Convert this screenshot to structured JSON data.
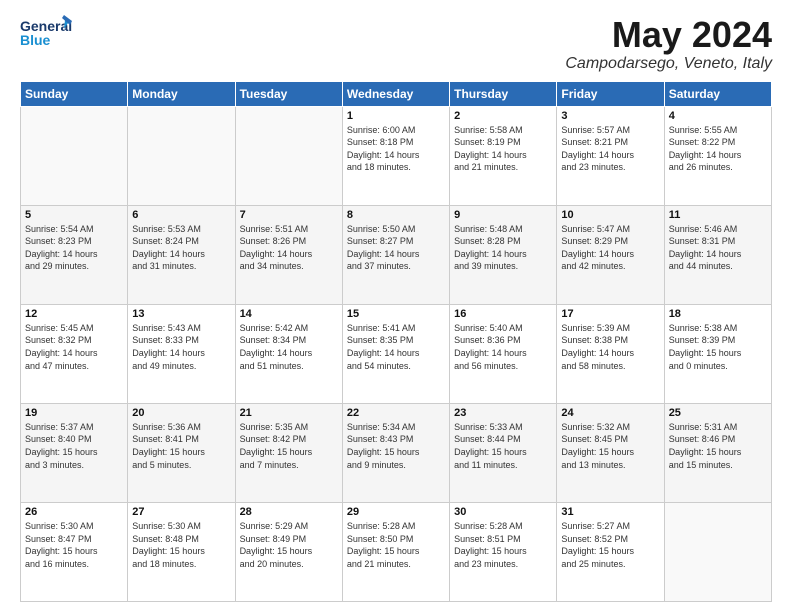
{
  "header": {
    "logo_line1": "General",
    "logo_line2": "Blue",
    "month_title": "May 2024",
    "location": "Campodarsego, Veneto, Italy"
  },
  "days_of_week": [
    "Sunday",
    "Monday",
    "Tuesday",
    "Wednesday",
    "Thursday",
    "Friday",
    "Saturday"
  ],
  "weeks": [
    [
      {
        "day": "",
        "info": ""
      },
      {
        "day": "",
        "info": ""
      },
      {
        "day": "",
        "info": ""
      },
      {
        "day": "1",
        "info": "Sunrise: 6:00 AM\nSunset: 8:18 PM\nDaylight: 14 hours\nand 18 minutes."
      },
      {
        "day": "2",
        "info": "Sunrise: 5:58 AM\nSunset: 8:19 PM\nDaylight: 14 hours\nand 21 minutes."
      },
      {
        "day": "3",
        "info": "Sunrise: 5:57 AM\nSunset: 8:21 PM\nDaylight: 14 hours\nand 23 minutes."
      },
      {
        "day": "4",
        "info": "Sunrise: 5:55 AM\nSunset: 8:22 PM\nDaylight: 14 hours\nand 26 minutes."
      }
    ],
    [
      {
        "day": "5",
        "info": "Sunrise: 5:54 AM\nSunset: 8:23 PM\nDaylight: 14 hours\nand 29 minutes."
      },
      {
        "day": "6",
        "info": "Sunrise: 5:53 AM\nSunset: 8:24 PM\nDaylight: 14 hours\nand 31 minutes."
      },
      {
        "day": "7",
        "info": "Sunrise: 5:51 AM\nSunset: 8:26 PM\nDaylight: 14 hours\nand 34 minutes."
      },
      {
        "day": "8",
        "info": "Sunrise: 5:50 AM\nSunset: 8:27 PM\nDaylight: 14 hours\nand 37 minutes."
      },
      {
        "day": "9",
        "info": "Sunrise: 5:48 AM\nSunset: 8:28 PM\nDaylight: 14 hours\nand 39 minutes."
      },
      {
        "day": "10",
        "info": "Sunrise: 5:47 AM\nSunset: 8:29 PM\nDaylight: 14 hours\nand 42 minutes."
      },
      {
        "day": "11",
        "info": "Sunrise: 5:46 AM\nSunset: 8:31 PM\nDaylight: 14 hours\nand 44 minutes."
      }
    ],
    [
      {
        "day": "12",
        "info": "Sunrise: 5:45 AM\nSunset: 8:32 PM\nDaylight: 14 hours\nand 47 minutes."
      },
      {
        "day": "13",
        "info": "Sunrise: 5:43 AM\nSunset: 8:33 PM\nDaylight: 14 hours\nand 49 minutes."
      },
      {
        "day": "14",
        "info": "Sunrise: 5:42 AM\nSunset: 8:34 PM\nDaylight: 14 hours\nand 51 minutes."
      },
      {
        "day": "15",
        "info": "Sunrise: 5:41 AM\nSunset: 8:35 PM\nDaylight: 14 hours\nand 54 minutes."
      },
      {
        "day": "16",
        "info": "Sunrise: 5:40 AM\nSunset: 8:36 PM\nDaylight: 14 hours\nand 56 minutes."
      },
      {
        "day": "17",
        "info": "Sunrise: 5:39 AM\nSunset: 8:38 PM\nDaylight: 14 hours\nand 58 minutes."
      },
      {
        "day": "18",
        "info": "Sunrise: 5:38 AM\nSunset: 8:39 PM\nDaylight: 15 hours\nand 0 minutes."
      }
    ],
    [
      {
        "day": "19",
        "info": "Sunrise: 5:37 AM\nSunset: 8:40 PM\nDaylight: 15 hours\nand 3 minutes."
      },
      {
        "day": "20",
        "info": "Sunrise: 5:36 AM\nSunset: 8:41 PM\nDaylight: 15 hours\nand 5 minutes."
      },
      {
        "day": "21",
        "info": "Sunrise: 5:35 AM\nSunset: 8:42 PM\nDaylight: 15 hours\nand 7 minutes."
      },
      {
        "day": "22",
        "info": "Sunrise: 5:34 AM\nSunset: 8:43 PM\nDaylight: 15 hours\nand 9 minutes."
      },
      {
        "day": "23",
        "info": "Sunrise: 5:33 AM\nSunset: 8:44 PM\nDaylight: 15 hours\nand 11 minutes."
      },
      {
        "day": "24",
        "info": "Sunrise: 5:32 AM\nSunset: 8:45 PM\nDaylight: 15 hours\nand 13 minutes."
      },
      {
        "day": "25",
        "info": "Sunrise: 5:31 AM\nSunset: 8:46 PM\nDaylight: 15 hours\nand 15 minutes."
      }
    ],
    [
      {
        "day": "26",
        "info": "Sunrise: 5:30 AM\nSunset: 8:47 PM\nDaylight: 15 hours\nand 16 minutes."
      },
      {
        "day": "27",
        "info": "Sunrise: 5:30 AM\nSunset: 8:48 PM\nDaylight: 15 hours\nand 18 minutes."
      },
      {
        "day": "28",
        "info": "Sunrise: 5:29 AM\nSunset: 8:49 PM\nDaylight: 15 hours\nand 20 minutes."
      },
      {
        "day": "29",
        "info": "Sunrise: 5:28 AM\nSunset: 8:50 PM\nDaylight: 15 hours\nand 21 minutes."
      },
      {
        "day": "30",
        "info": "Sunrise: 5:28 AM\nSunset: 8:51 PM\nDaylight: 15 hours\nand 23 minutes."
      },
      {
        "day": "31",
        "info": "Sunrise: 5:27 AM\nSunset: 8:52 PM\nDaylight: 15 hours\nand 25 minutes."
      },
      {
        "day": "",
        "info": ""
      }
    ]
  ]
}
